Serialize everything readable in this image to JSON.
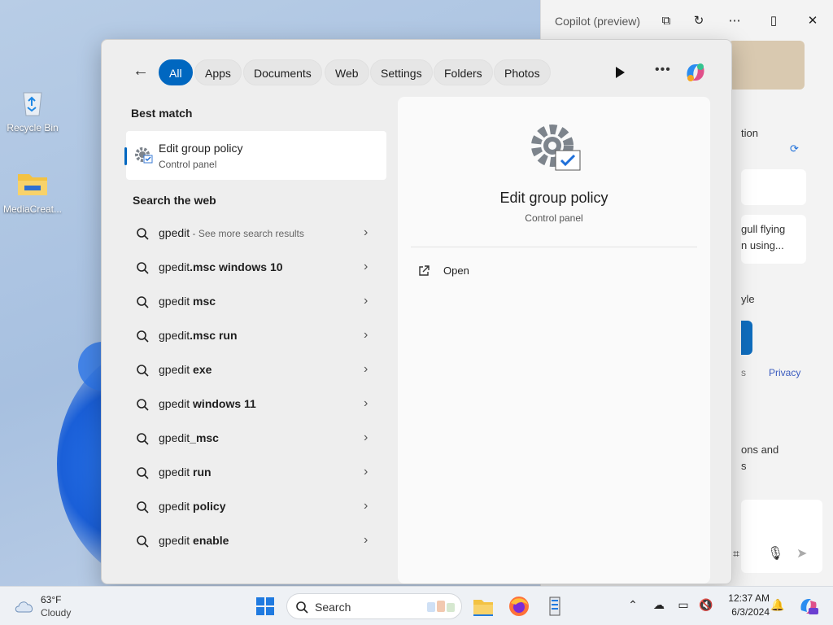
{
  "desktop": {
    "icons": [
      {
        "label": "Recycle Bin",
        "icon": "recycle-bin-icon"
      },
      {
        "label": "MediaCreat...",
        "icon": "folder-icon"
      }
    ]
  },
  "copilot": {
    "title": "Copilot (preview)",
    "fragments": {
      "f1": "tion",
      "f2": "gull flying",
      "f3": "n using...",
      "f4": "yle",
      "f5": "s",
      "f6": "Privacy",
      "f7": "ons and",
      "f8": "s"
    }
  },
  "search": {
    "tabs": [
      "All",
      "Apps",
      "Documents",
      "Web",
      "Settings",
      "Folders",
      "Photos"
    ],
    "best_match_heading": "Best match",
    "best_match": {
      "title": "Edit group policy",
      "subtitle": "Control panel"
    },
    "web_heading": "Search the web",
    "web_results": [
      {
        "prefix": "gpedit",
        "bold": "",
        "suffix": " - See more search results"
      },
      {
        "prefix": "gpedit",
        "bold": ".msc windows 10",
        "suffix": ""
      },
      {
        "prefix": "gpedit",
        "bold": " msc",
        "suffix": ""
      },
      {
        "prefix": "gpedit",
        "bold": ".msc run",
        "suffix": ""
      },
      {
        "prefix": "gpedit",
        "bold": " exe",
        "suffix": ""
      },
      {
        "prefix": "gpedit",
        "bold": " windows 11",
        "suffix": ""
      },
      {
        "prefix": "gpedit",
        "bold": "_msc",
        "suffix": ""
      },
      {
        "prefix": "gpedit",
        "bold": " run",
        "suffix": ""
      },
      {
        "prefix": "gpedit",
        "bold": " policy",
        "suffix": ""
      },
      {
        "prefix": "gpedit",
        "bold": " enable",
        "suffix": ""
      }
    ],
    "detail": {
      "title": "Edit group policy",
      "subtitle": "Control panel",
      "action": "Open"
    }
  },
  "taskbar": {
    "weather": {
      "temp": "63°F",
      "condition": "Cloudy"
    },
    "search_label": "Search",
    "time": "12:37 AM",
    "date": "6/3/2024"
  }
}
